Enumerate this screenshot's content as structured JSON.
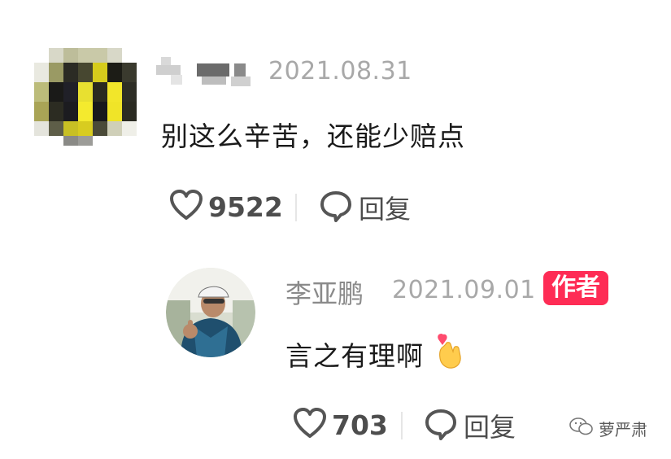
{
  "comment": {
    "date": "2021.08.31",
    "text": "别这么辛苦，还能少赔点",
    "likes": "9522",
    "reply_label": "回复"
  },
  "reply": {
    "username": "李亚鹏",
    "date": "2021.09.01",
    "badge": "作者",
    "text": "言之有理啊",
    "emoji": "🫰",
    "likes": "703",
    "reply_label": "回复"
  },
  "watermark": {
    "text": "萝严肃"
  },
  "colors": {
    "accent": "#fe2c55",
    "date_gray": "#a8a8a8",
    "text": "#1a1a1a"
  }
}
